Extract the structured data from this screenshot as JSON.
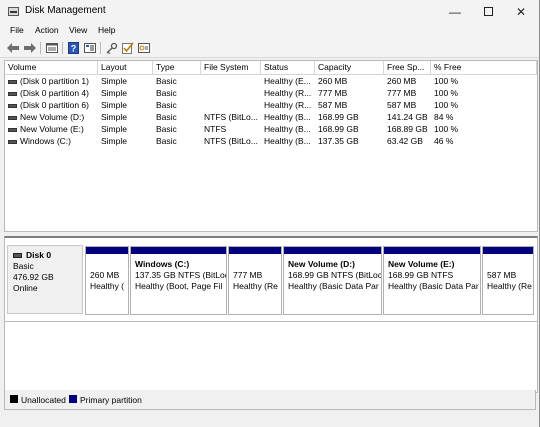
{
  "window": {
    "title": "Disk Management"
  },
  "menu": [
    "File",
    "Action",
    "View",
    "Help"
  ],
  "toolbar": [
    {
      "name": "back-icon"
    },
    {
      "name": "forward-icon"
    },
    {
      "name": "list-view-icon"
    },
    {
      "name": "help-icon"
    },
    {
      "name": "properties-icon"
    },
    {
      "name": "key-icon"
    },
    {
      "name": "check-icon"
    },
    {
      "name": "settings-icon"
    }
  ],
  "columns": [
    "Volume",
    "Layout",
    "Type",
    "File System",
    "Status",
    "Capacity",
    "Free Sp...",
    "% Free"
  ],
  "volumes": [
    [
      "(Disk 0 partition 1)",
      "Simple",
      "Basic",
      "",
      "Healthy (E...",
      "260 MB",
      "260 MB",
      "100 %"
    ],
    [
      "(Disk 0 partition 4)",
      "Simple",
      "Basic",
      "",
      "Healthy (R...",
      "777 MB",
      "777 MB",
      "100 %"
    ],
    [
      "(Disk 0 partition 6)",
      "Simple",
      "Basic",
      "",
      "Healthy (R...",
      "587 MB",
      "587 MB",
      "100 %"
    ],
    [
      "New Volume (D:)",
      "Simple",
      "Basic",
      "NTFS (BitLo...",
      "Healthy (B...",
      "168.99 GB",
      "141.24 GB",
      "84 %"
    ],
    [
      "New Volume (E:)",
      "Simple",
      "Basic",
      "NTFS",
      "Healthy (B...",
      "168.99 GB",
      "168.89 GB",
      "100 %"
    ],
    [
      "Windows (C:)",
      "Simple",
      "Basic",
      "NTFS (BitLo...",
      "Healthy (B...",
      "137.35 GB",
      "63.42 GB",
      "46 %"
    ]
  ],
  "disk": {
    "name": "Disk 0",
    "type": "Basic",
    "size": "476.92 GB",
    "state": "Online"
  },
  "partitions": [
    {
      "name": "",
      "size": "260 MB",
      "status": "Healthy ("
    },
    {
      "name": "Windows  (C:)",
      "size": "137.35 GB NTFS (BitLoc",
      "status": "Healthy (Boot, Page Fil"
    },
    {
      "name": "",
      "size": "777 MB",
      "status": "Healthy (Re"
    },
    {
      "name": "New Volume  (D:)",
      "size": "168.99 GB NTFS (BitLoc",
      "status": "Healthy (Basic Data Par"
    },
    {
      "name": "New Volume  (E:)",
      "size": "168.99 GB NTFS",
      "status": "Healthy (Basic Data Par"
    },
    {
      "name": "",
      "size": "587 MB",
      "status": "Healthy (Re"
    }
  ],
  "legend": [
    {
      "label": "Unallocated",
      "color": "#000000"
    },
    {
      "label": "Primary partition",
      "color": "#00007f"
    }
  ]
}
